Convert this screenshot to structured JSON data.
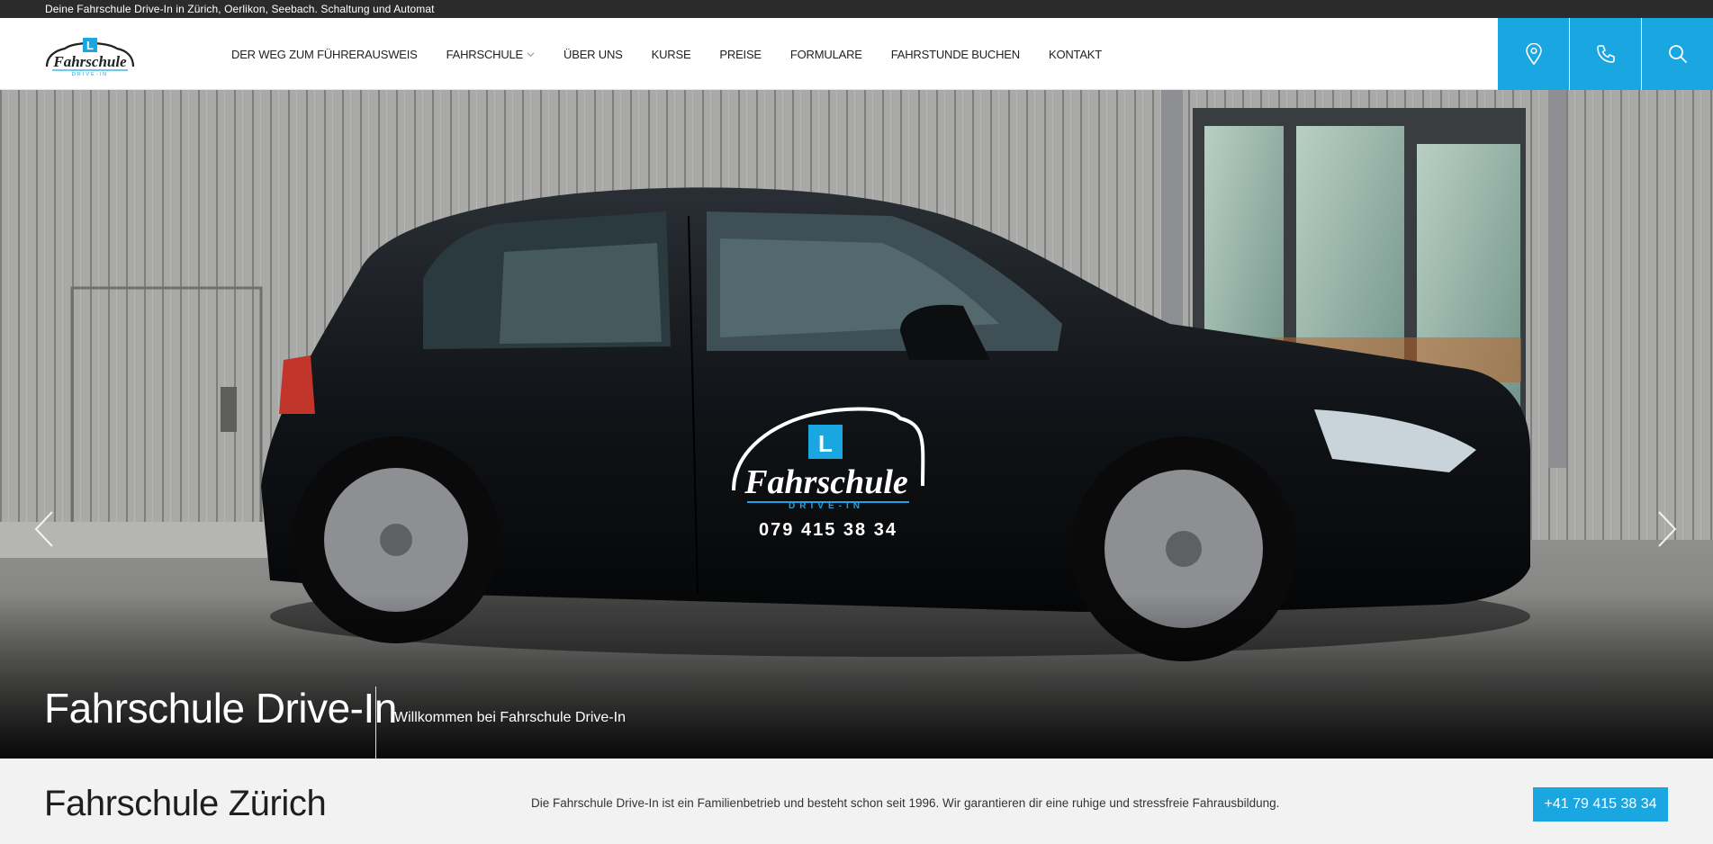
{
  "topbar": {
    "text": "Deine Fahrschule Drive-In in Zürich, Oerlikon, Seebach. Schaltung und Automat"
  },
  "header": {
    "logo_alt": "Fahrschule Drive-In",
    "nav": [
      {
        "label": "Der Weg zum Führerausweis"
      },
      {
        "label": "Fahrschule",
        "has_dropdown": true
      },
      {
        "label": "Über uns"
      },
      {
        "label": "Kurse"
      },
      {
        "label": "Preise"
      },
      {
        "label": "Formulare"
      },
      {
        "label": "Fahrstunde buchen"
      },
      {
        "label": "Kontakt"
      }
    ],
    "icons": [
      "location-pin-icon",
      "phone-icon",
      "search-icon"
    ]
  },
  "hero": {
    "title": "Fahrschule Drive-In",
    "subtitle": "Willkommen bei Fahrschule Drive-In",
    "car_logo_text": "Fahrschule",
    "car_logo_sub": "DRIVE-IN",
    "car_phone": "079 415 38 34"
  },
  "intro": {
    "title": "Fahrschule Zürich",
    "text": "Die Fahrschule Drive-In ist ein Familienbetrieb und besteht schon seit 1996. Wir garantieren dir eine ruhige und stressfreie Fahrausbildung.",
    "phone_button": "+41 79 415 38 34"
  },
  "colors": {
    "accent": "#1aa6e0",
    "topbar": "#2b2b2b",
    "strip": "#f2f2f2"
  }
}
